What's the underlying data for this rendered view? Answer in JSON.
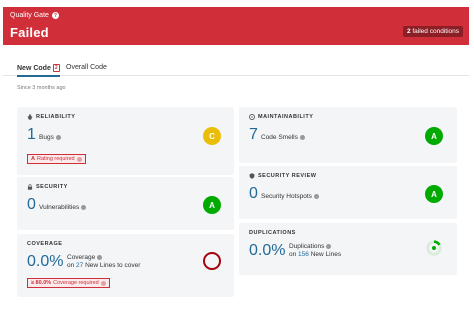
{
  "gate": {
    "label": "Quality Gate",
    "help_icon": "?",
    "status": "Failed",
    "conditions_count": "2",
    "conditions_text": "failed conditions"
  },
  "tabs": {
    "new_code": "New Code",
    "new_code_badge": "2",
    "overall": "Overall Code"
  },
  "since": "Since 3 months ago",
  "reliability": {
    "title": "RELIABILITY",
    "value": "1",
    "metric": "Bugs",
    "grade": "C",
    "fail_prefix": "A",
    "fail_text": "Rating required"
  },
  "maintainability": {
    "title": "MAINTAINABILITY",
    "value": "7",
    "metric": "Code Smells",
    "grade": "A"
  },
  "security": {
    "title": "SECURITY",
    "value": "0",
    "metric": "Vulnerabilities",
    "grade": "A"
  },
  "security_review": {
    "title": "SECURITY REVIEW",
    "value": "0",
    "metric": "Security Hotspots",
    "grade": "A"
  },
  "coverage": {
    "title": "COVERAGE",
    "value": "0.0%",
    "metric": "Coverage",
    "on_prefix": "on",
    "lines_count": "27",
    "lines_text": "New Lines to cover",
    "fail_prefix": "≥ 80.0%",
    "fail_text": "Coverage required"
  },
  "duplications": {
    "title": "DUPLICATIONS",
    "value": "0.0%",
    "metric": "Duplications",
    "on_prefix": "on",
    "lines_count": "156",
    "lines_text": "New Lines"
  },
  "colors": {
    "fail_red": "#d02f3a",
    "link_blue": "#236a97",
    "grade_a": "#00aa00",
    "grade_c": "#eabe06"
  }
}
